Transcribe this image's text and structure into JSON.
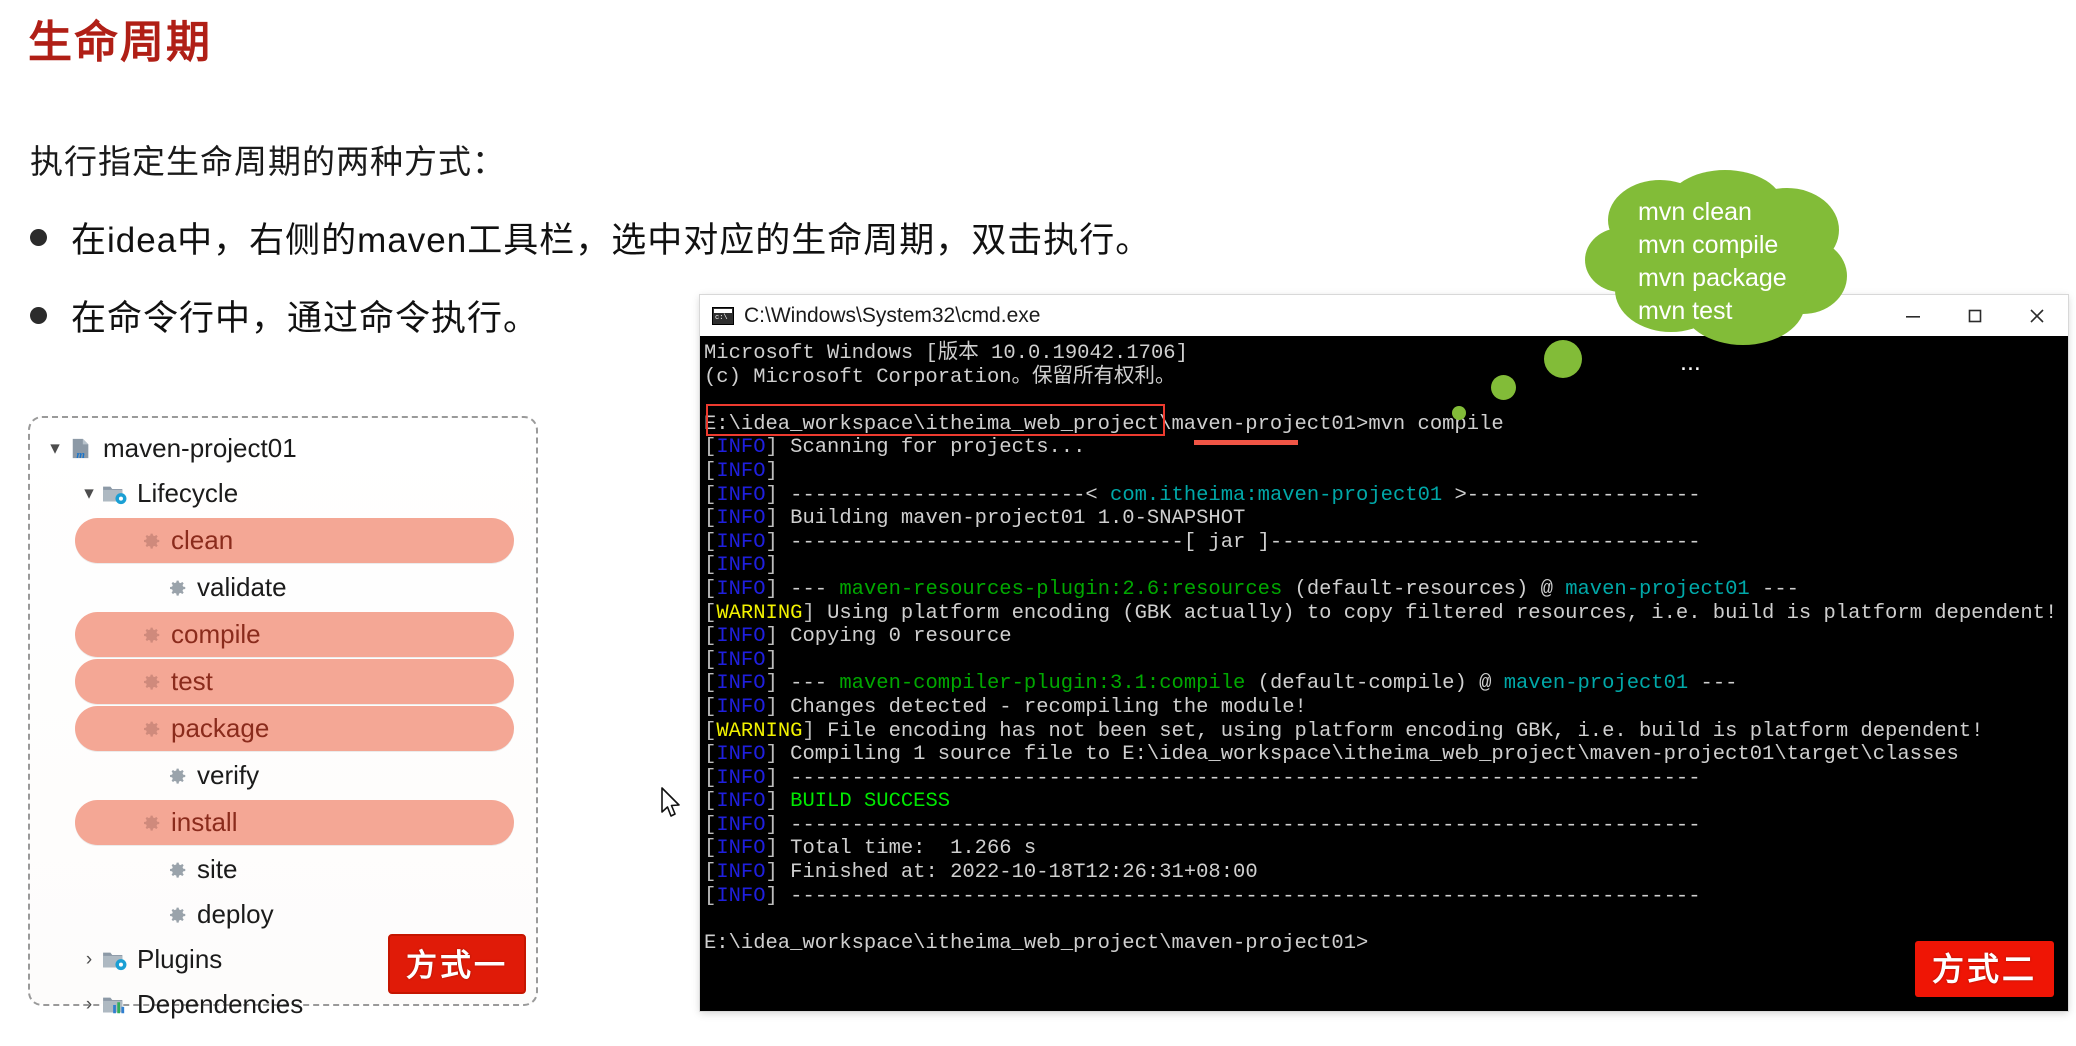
{
  "slide": {
    "title": "生命周期",
    "intro": "执行指定生命周期的两种方式：",
    "bullets": [
      "在idea中，右侧的maven工具栏，选中对应的生命周期，双击执行。",
      "在命令行中，通过命令执行。"
    ]
  },
  "tree_panel": {
    "badge": "方式一",
    "nodes": [
      {
        "label": "maven-project01",
        "level": 0,
        "chevron": "▾",
        "icon": "maven-module-icon",
        "highlighted": false
      },
      {
        "label": "Lifecycle",
        "level": 1,
        "chevron": "▾",
        "icon": "folder-gear-icon",
        "highlighted": false
      },
      {
        "label": "clean",
        "level": 2,
        "chevron": "",
        "icon": "gear-icon",
        "highlighted": true
      },
      {
        "label": "validate",
        "level": 2,
        "chevron": "",
        "icon": "gear-icon",
        "highlighted": false
      },
      {
        "label": "compile",
        "level": 2,
        "chevron": "",
        "icon": "gear-icon",
        "highlighted": true
      },
      {
        "label": "test",
        "level": 2,
        "chevron": "",
        "icon": "gear-icon",
        "highlighted": true
      },
      {
        "label": "package",
        "level": 2,
        "chevron": "",
        "icon": "gear-icon",
        "highlighted": true
      },
      {
        "label": "verify",
        "level": 2,
        "chevron": "",
        "icon": "gear-icon",
        "highlighted": false
      },
      {
        "label": "install",
        "level": 2,
        "chevron": "",
        "icon": "gear-icon",
        "highlighted": true
      },
      {
        "label": "site",
        "level": 2,
        "chevron": "",
        "icon": "gear-icon",
        "highlighted": false
      },
      {
        "label": "deploy",
        "level": 2,
        "chevron": "",
        "icon": "gear-icon",
        "highlighted": false
      },
      {
        "label": "Plugins",
        "level": 1,
        "chevron": "›",
        "icon": "folder-gear-icon",
        "highlighted": false
      },
      {
        "label": "Dependencies",
        "level": 1,
        "chevron": "›",
        "icon": "folder-chart-icon",
        "highlighted": false
      }
    ]
  },
  "terminal": {
    "title": "C:\\Windows\\System32\\cmd.exe",
    "window_buttons": {
      "minimize": "–",
      "maximize": "□",
      "close": "✕"
    },
    "badge": "方式二",
    "prompt_path": "E:\\idea_workspace\\itheima_web_project\\maven-project01",
    "typed_command": "mvn compile",
    "final_prompt": "E:\\idea_workspace\\itheima_web_project\\maven-project01>",
    "header_lines": [
      "Microsoft Windows [版本 10.0.19042.1706]",
      "(c) Microsoft Corporation。保留所有权利。"
    ],
    "lines": [
      {
        "tag": "INFO",
        "text": "Scanning for projects..."
      },
      {
        "tag": "INFO",
        "text": ""
      },
      {
        "tag": "INFO",
        "text": "------------------------< com.itheima:maven-project01 >-------------------"
      },
      {
        "tag": "INFO",
        "text": "Building maven-project01 1.0-SNAPSHOT"
      },
      {
        "tag": "INFO",
        "text": "--------------------------------[ jar ]-----------------------------------"
      },
      {
        "tag": "INFO",
        "text": ""
      },
      {
        "tag": "INFO",
        "text": "--- maven-resources-plugin:2.6:resources (default-resources) @ maven-project01 ---"
      },
      {
        "tag": "WARNING",
        "text": "Using platform encoding (GBK actually) to copy filtered resources, i.e. build is platform dependent!"
      },
      {
        "tag": "INFO",
        "text": "Copying 0 resource"
      },
      {
        "tag": "INFO",
        "text": ""
      },
      {
        "tag": "INFO",
        "text": "--- maven-compiler-plugin:3.1:compile (default-compile) @ maven-project01 ---"
      },
      {
        "tag": "INFO",
        "text": "Changes detected - recompiling the module!"
      },
      {
        "tag": "WARNING",
        "text": "File encoding has not been set, using platform encoding GBK, i.e. build is platform dependent!"
      },
      {
        "tag": "INFO",
        "text": "Compiling 1 source file to E:\\idea_workspace\\itheima_web_project\\maven-project01\\target\\classes"
      },
      {
        "tag": "INFO",
        "text": "--------------------------------------------------------------------------"
      },
      {
        "tag": "INFO",
        "text": "BUILD SUCCESS"
      },
      {
        "tag": "INFO",
        "text": "--------------------------------------------------------------------------"
      },
      {
        "tag": "INFO",
        "text": "Total time:  1.266 s"
      },
      {
        "tag": "INFO",
        "text": "Finished at: 2022-10-18T12:26:31+08:00"
      },
      {
        "tag": "INFO",
        "text": "--------------------------------------------------------------------------"
      }
    ]
  },
  "thought_bubble": {
    "commands": [
      "mvn clean",
      "mvn compile",
      "mvn package",
      "mvn test"
    ],
    "ellipsis": "..."
  },
  "colors": {
    "title_red": "#b01f16",
    "badge_red": "#e01b08",
    "pill_salmon": "#f4a795",
    "bubble_green": "#82bc38",
    "terminal_bg": "#000000",
    "info_blue": "#1f1fde",
    "warning_yellow": "#f2f200",
    "success_green": "#00e800",
    "plugin_green": "#00a800",
    "artifact_cyan": "#00a8a8",
    "highlight_box_red": "#ee3b2f"
  }
}
